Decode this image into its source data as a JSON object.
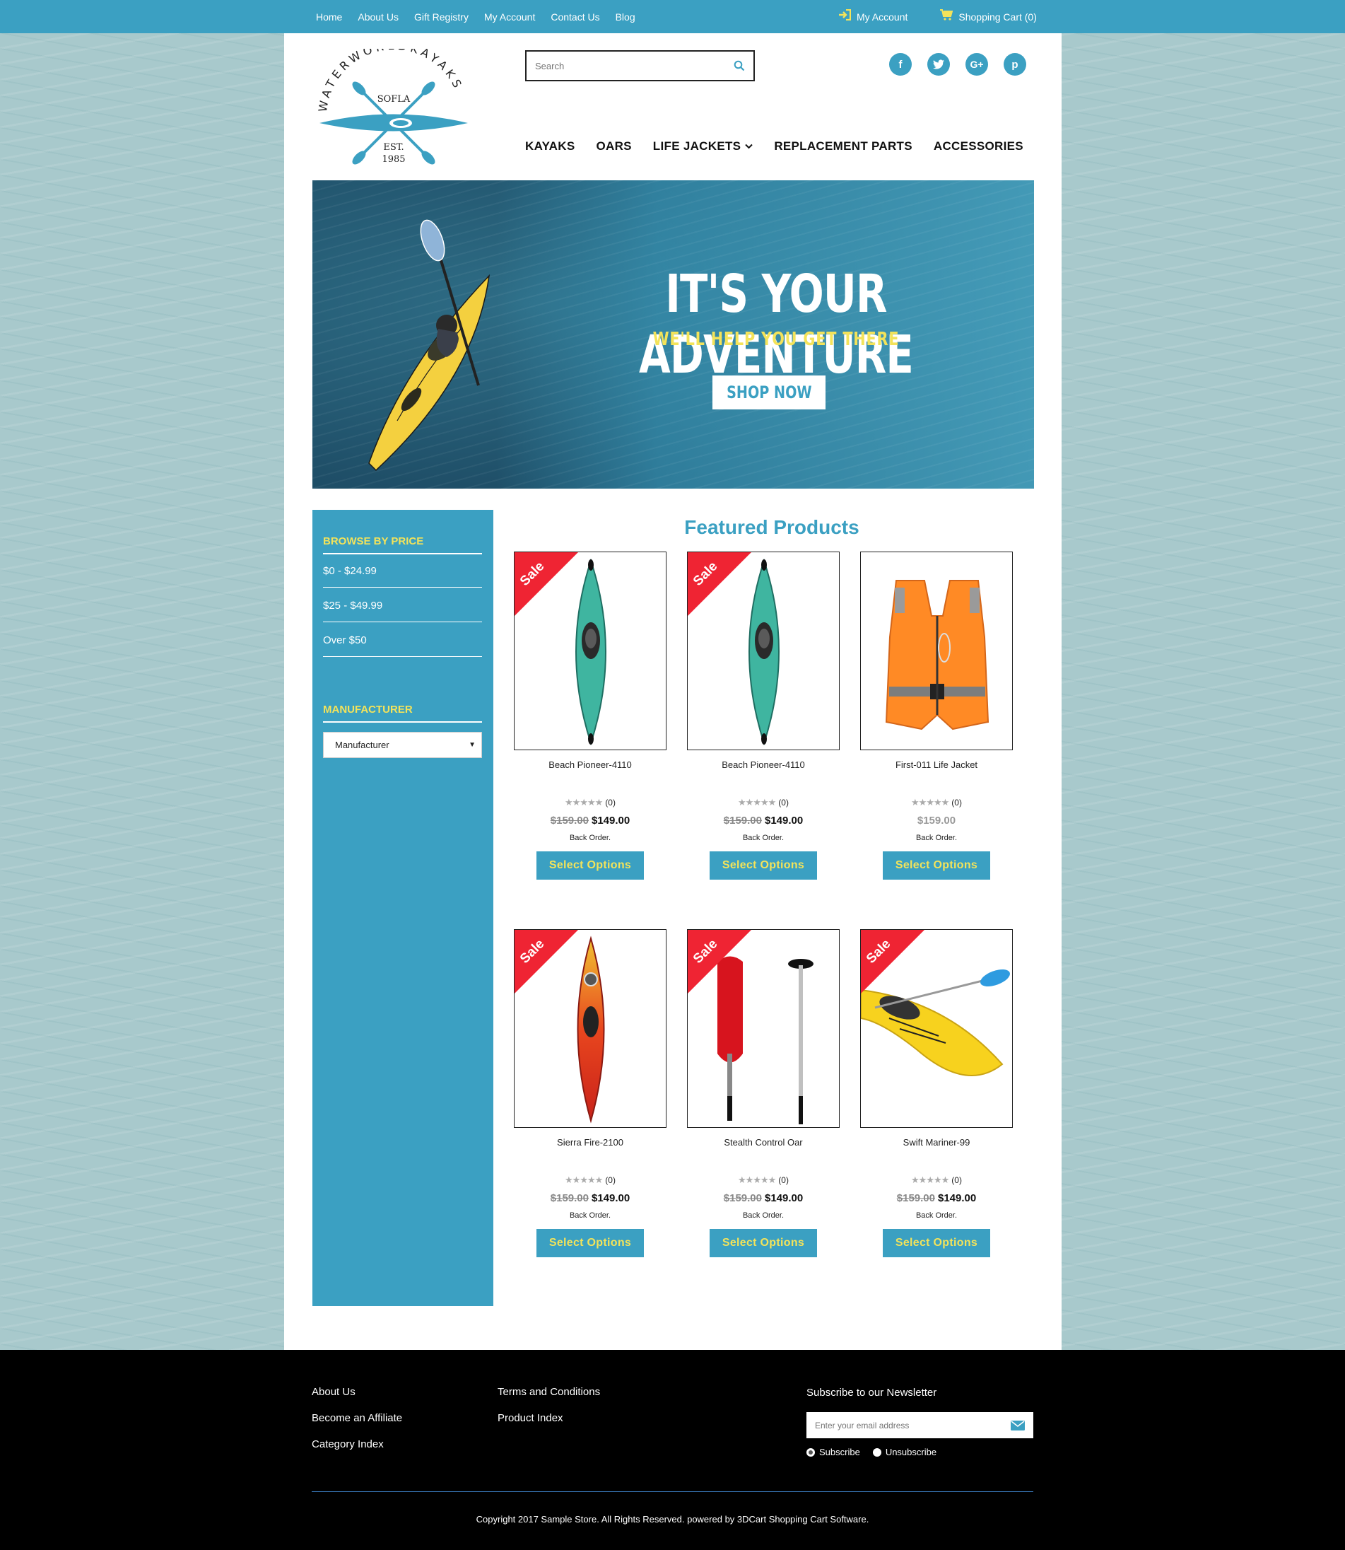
{
  "topbar": {
    "links": [
      "Home",
      "About Us",
      "Gift Registry",
      "My Account",
      "Contact Us",
      "Blog"
    ],
    "account_label": "My Account",
    "cart_label": "Shopping Cart (0)",
    "bg_color": "#3ba0c2"
  },
  "logo": {
    "arc_text": "WATERWORLDKAYAKS",
    "region": "SOFLA",
    "est": "EST.",
    "year": "1985"
  },
  "search": {
    "placeholder": "Search"
  },
  "social": [
    "facebook-icon",
    "twitter-icon",
    "google-plus-icon",
    "pinterest-icon"
  ],
  "mainnav": {
    "items": [
      "KAYAKS",
      "OARS",
      "LIFE JACKETS",
      "REPLACEMENT PARTS",
      "ACCESSORIES"
    ]
  },
  "hero": {
    "title": "IT'S YOUR ADVENTURE",
    "subtitle": "WE'LL HELP YOU GET THERE",
    "button": "SHOP NOW"
  },
  "sidebar": {
    "price_heading": "BROWSE BY PRICE",
    "price_links": [
      "$0 - $24.99",
      "$25 - $49.99",
      "Over $50"
    ],
    "manufacturer_heading": "MANUFACTURER",
    "manufacturer_select": "Manufacturer"
  },
  "featured": {
    "title": "Featured Products",
    "sale_label": "Sale",
    "button_label": "Select Options",
    "products": [
      {
        "name": "Beach Pioneer-4110",
        "rating_count": "(0)",
        "old_price": "$159.00",
        "price": "$149.00",
        "stock": "Back Order.",
        "sale": true,
        "image": "green-kayak"
      },
      {
        "name": "Beach Pioneer-4110",
        "rating_count": "(0)",
        "old_price": "$159.00",
        "price": "$149.00",
        "stock": "Back Order.",
        "sale": true,
        "image": "green-kayak"
      },
      {
        "name": "First-011 Life Jacket",
        "rating_count": "(0)",
        "old_price": "",
        "price": "$159.00",
        "stock": "Back Order.",
        "sale": false,
        "image": "life-jacket"
      },
      {
        "name": "Sierra Fire-2100",
        "rating_count": "(0)",
        "old_price": "$159.00",
        "price": "$149.00",
        "stock": "Back Order.",
        "sale": true,
        "image": "red-kayak"
      },
      {
        "name": "Stealth Control Oar",
        "rating_count": "(0)",
        "old_price": "$159.00",
        "price": "$149.00",
        "stock": "Back Order.",
        "sale": true,
        "image": "oar"
      },
      {
        "name": "Swift Mariner-99",
        "rating_count": "(0)",
        "old_price": "$159.00",
        "price": "$149.00",
        "stock": "Back Order.",
        "sale": true,
        "image": "yellow-kayak"
      }
    ]
  },
  "footer": {
    "col1": [
      "About Us",
      "Become an Affiliate",
      "Category Index"
    ],
    "col2": [
      "Terms and Conditions",
      "Product Index"
    ],
    "newsletter_title": "Subscribe to our Newsletter",
    "email_placeholder": "Enter your email address",
    "subscribe": "Subscribe",
    "unsubscribe": "Unsubscribe",
    "copyright": "Copyright 2017 Sample Store. All Rights Reserved. powered by 3DCart Shopping Cart Software."
  },
  "colors": {
    "accent": "#3ba0c2",
    "highlight": "#f3e35a",
    "sale": "#ef2433"
  }
}
